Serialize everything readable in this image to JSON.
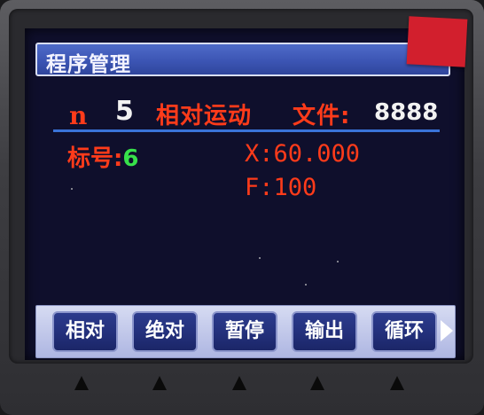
{
  "header": {
    "title": "程序管理"
  },
  "status": {
    "n_label": "n",
    "n_value": "5",
    "mode": "相对运动",
    "file_label": "文件:",
    "file_value": "8888"
  },
  "program": {
    "label_prefix": "标号:",
    "label_value": "6",
    "x_line": "X:60.000",
    "f_line": "F:100"
  },
  "softkeys": {
    "relative": "相对",
    "absolute": "绝对",
    "pause": "暂停",
    "output": "输出",
    "loop": "循环"
  },
  "colors": {
    "screen_bg": "#0f0f2c",
    "accent_red": "#ff3b1a",
    "accent_green": "#37e14a",
    "title_bar_blue": "#3c55b4",
    "softkey_blue": "#23307b"
  },
  "icons": {
    "softkey_next": "triangle-right-icon",
    "hardware_buttons": "triangle-up-icon"
  }
}
